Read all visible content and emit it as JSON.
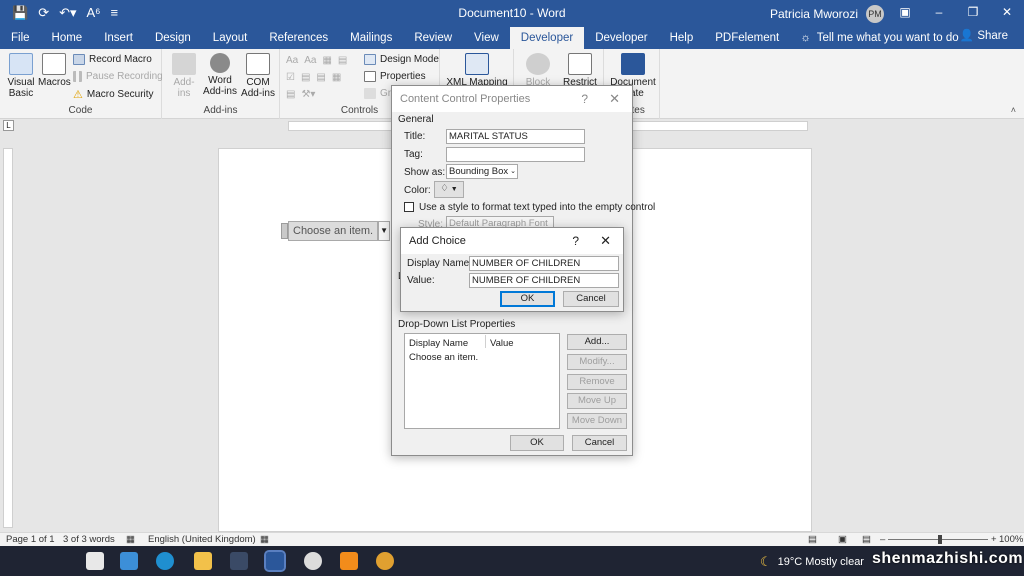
{
  "window": {
    "title": "Document10  -  Word",
    "user_name": "Patricia Mworozi",
    "user_initials": "PM"
  },
  "tabs": [
    "File",
    "Home",
    "Insert",
    "Design",
    "Layout",
    "References",
    "Mailings",
    "Review",
    "View",
    "Developer",
    "Developer",
    "Help",
    "PDFelement"
  ],
  "active_tab_index": 9,
  "tell_me": "Tell me what you want to do",
  "share_label": "Share",
  "ribbon": {
    "code": {
      "label": "Code",
      "visual_basic": "Visual\nBasic",
      "macros": "Macros",
      "record_macro": "Record Macro",
      "pause_recording": "Pause Recording",
      "macro_security": "Macro Security"
    },
    "addins": {
      "label": "Add-ins",
      "addins": "Add-\nins",
      "word_addins": "Word\nAdd-ins",
      "com_addins": "COM\nAdd-ins"
    },
    "controls": {
      "label": "Controls",
      "design_mode": "Design Mode",
      "properties": "Properties",
      "group": "Gro"
    },
    "mapping": {
      "xml_mapping": "XML Mapping"
    },
    "protect": {
      "block": "Block",
      "restrict": "Restrict"
    },
    "templates": {
      "document": "Document",
      "template": "plate",
      "label": "plates"
    }
  },
  "document": {
    "content_control_text": "Choose an item."
  },
  "ccp_dialog": {
    "title": "Content Control Properties",
    "general_section": "General",
    "title_label": "Title:",
    "title_value": "MARITAL STATUS",
    "tag_label": "Tag:",
    "tag_value": "",
    "show_as_label": "Show as:",
    "show_as_value": "Bounding Box",
    "color_label": "Color:",
    "use_style_label": "Use a style to format text typed into the empty control",
    "style_label": "Style:",
    "style_value": "Default Paragraph Font",
    "hidden_l": "L",
    "dropdown_section": "Drop-Down List Properties",
    "col_display_name": "Display Name",
    "col_value": "Value",
    "list_items": [
      "Choose an item."
    ],
    "add": "Add...",
    "modify": "Modify...",
    "remove": "Remove",
    "move_up": "Move Up",
    "move_down": "Move Down",
    "ok": "OK",
    "cancel": "Cancel"
  },
  "add_choice_dialog": {
    "title": "Add Choice",
    "display_name_label": "Display Name:",
    "display_name_value": "NUMBER OF CHILDREN",
    "value_label": "Value:",
    "value_value": "NUMBER OF CHILDREN",
    "ok": "OK",
    "cancel": "Cancel"
  },
  "status": {
    "page": "Page 1 of 1",
    "words": "3 of 3 words",
    "language": "English (United Kingdom)",
    "zoom": "100%"
  },
  "taskbar": {
    "weather": "19°C  Mostly clear"
  },
  "watermark": "shenmazhishi.com"
}
